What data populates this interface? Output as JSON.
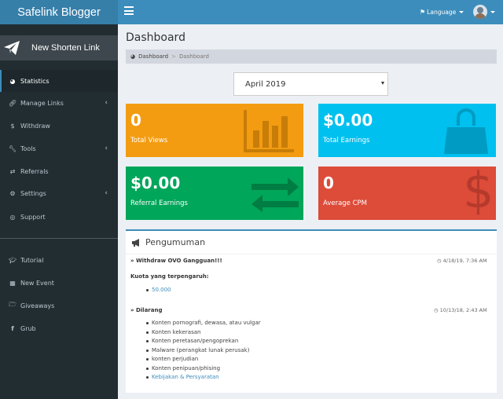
{
  "brand": "Safelink Blogger",
  "header": {
    "language_label": "Language"
  },
  "sidebar": {
    "shorten_label": "New Shorten Link",
    "items": [
      {
        "label": "Statistics",
        "icon": "dashboard-icon",
        "active": true
      },
      {
        "label": "Manage Links",
        "icon": "link-icon",
        "has_children": true
      },
      {
        "label": "Withdraw",
        "icon": "dollar-icon"
      },
      {
        "label": "Tools",
        "icon": "wrench-icon",
        "has_children": true
      },
      {
        "label": "Referrals",
        "icon": "exchange-icon"
      },
      {
        "label": "Settings",
        "icon": "gears-icon",
        "has_children": true
      },
      {
        "label": "Support",
        "icon": "life-ring-icon"
      }
    ],
    "extra_items": [
      {
        "label": "Tutorial",
        "icon": "graduation-cap-icon"
      },
      {
        "label": "New Event",
        "icon": "calendar-icon"
      },
      {
        "label": "Giveaways",
        "icon": "folder-open-icon"
      },
      {
        "label": "Grub",
        "icon": "facebook-icon"
      }
    ]
  },
  "main": {
    "title": "Dashboard",
    "breadcrumb": [
      "Dashboard",
      "Dashboard"
    ],
    "month_selected": "April 2019",
    "stats": [
      {
        "value": "0",
        "label": "Total Views",
        "color": "#f39c12",
        "icon": "bar-chart-icon"
      },
      {
        "value": "$0.00",
        "label": "Total Earnings",
        "color": "#00c0ef",
        "icon": "shopping-bag-icon"
      },
      {
        "value": "$0.00",
        "label": "Referral Earnings",
        "color": "#00a65a",
        "icon": "exchange-arrows-icon"
      },
      {
        "value": "0",
        "label": "Average CPM",
        "color": "#dd4b39",
        "icon": "dollar-icon"
      }
    ]
  },
  "announcements": {
    "title": "Pengumuman",
    "entries": [
      {
        "title": "» Withdraw OVO Gangguan!!!",
        "time": "4/18/19, 7:36 AM",
        "subtitle": "Kuota yang terpengaruh:",
        "items": [
          "50.000"
        ]
      },
      {
        "title": "» Dilarang",
        "time": "10/13/18, 2:43 AM",
        "items": [
          "Konten pornografi, dewasa, atau vulgar",
          "Konten kekerasan",
          "Konten peretasan/pengoprekan",
          "Malware (perangkat lunak perusak)",
          "konten perjudian",
          "Konten penipuan/phising",
          "Kebijakan & Persyaratan"
        ]
      }
    ]
  }
}
